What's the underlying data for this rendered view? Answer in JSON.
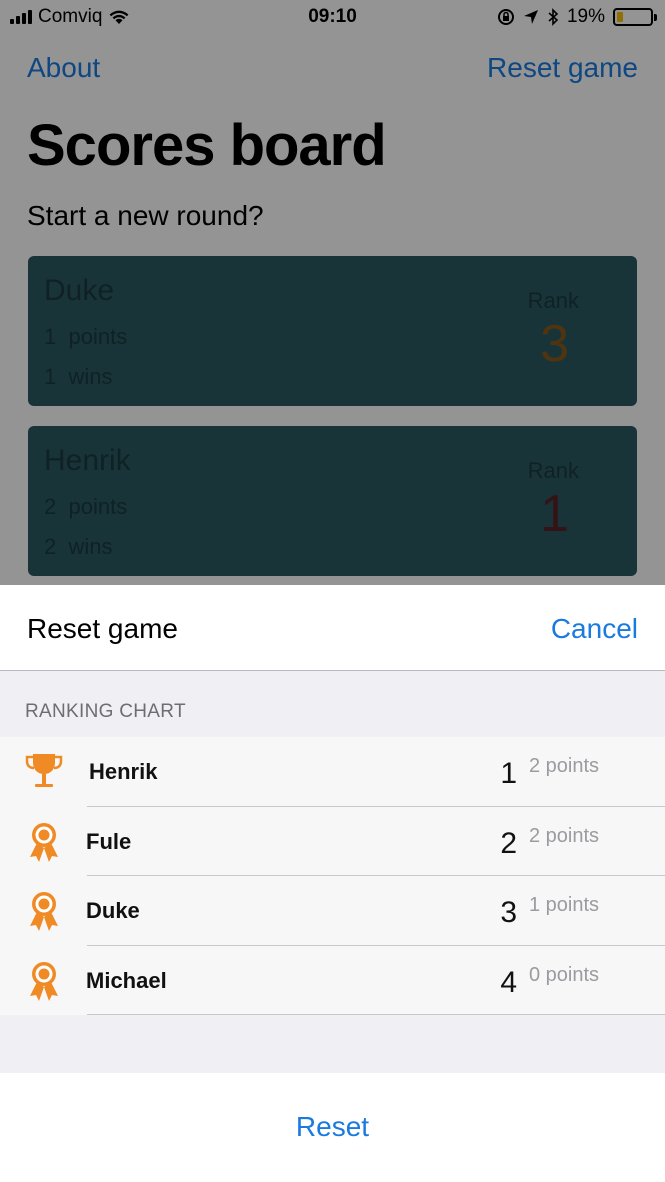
{
  "status_bar": {
    "carrier": "Comviq",
    "time": "09:10",
    "battery": "19%",
    "battery_level": 0.19
  },
  "nav": {
    "about": "About",
    "reset_game": "Reset game"
  },
  "page": {
    "title": "Scores board",
    "subtitle": "Start a new round?"
  },
  "cards": [
    {
      "name": "Duke",
      "points": "1",
      "points_label": "points",
      "wins": "1",
      "wins_label": "wins",
      "rank_label": "Rank",
      "rank": "3",
      "rank_color": "#8a5a1c"
    },
    {
      "name": "Henrik",
      "points": "2",
      "points_label": "points",
      "wins": "2",
      "wins_label": "wins",
      "rank_label": "Rank",
      "rank": "1",
      "rank_color": "#5a1f25"
    }
  ],
  "sheet": {
    "title": "Reset game",
    "cancel": "Cancel",
    "section_header": "RANKING CHART",
    "rows": [
      {
        "icon": "trophy-icon",
        "name": "Henrik",
        "position": "1",
        "points": "2 points"
      },
      {
        "icon": "medal-icon",
        "name": "Fule",
        "position": "2",
        "points": "2 points"
      },
      {
        "icon": "medal-icon",
        "name": "Duke",
        "position": "3",
        "points": "1 points"
      },
      {
        "icon": "medal-icon",
        "name": "Michael",
        "position": "4",
        "points": "0 points"
      }
    ],
    "reset_button": "Reset"
  },
  "colors": {
    "accent": "#1a7ae0",
    "icon_orange": "#f08a24",
    "card_bg": "#2a5a63"
  }
}
